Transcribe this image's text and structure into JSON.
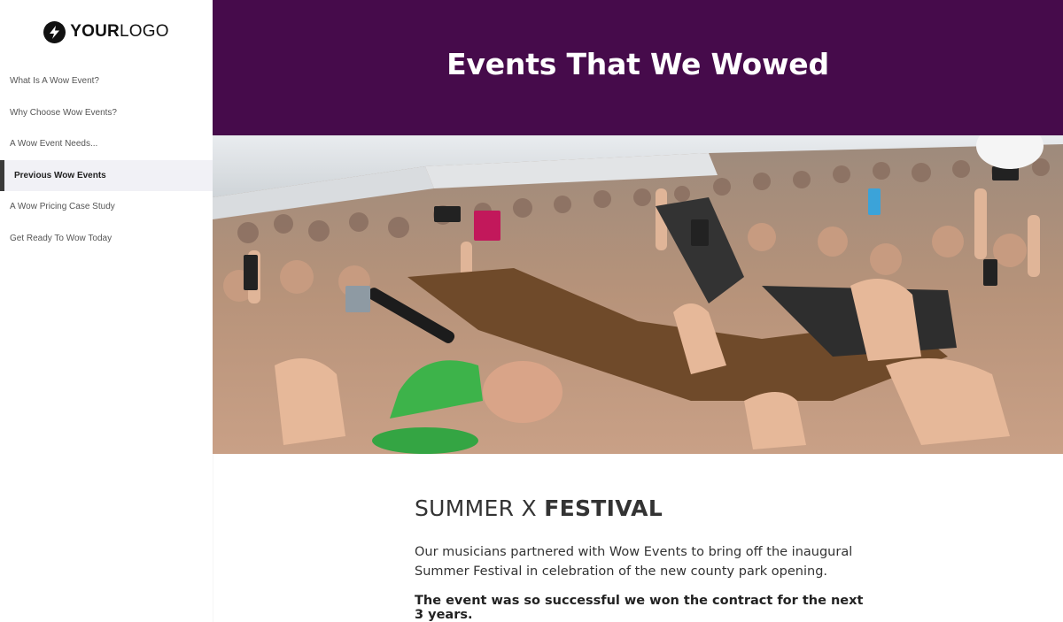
{
  "logo": {
    "bold": "YOUR",
    "light": "LOGO",
    "icon": "lightning-bolt-icon"
  },
  "sidebar": {
    "items": [
      {
        "label": "What Is A Wow Event?"
      },
      {
        "label": "Why Choose Wow Events?"
      },
      {
        "label": "A Wow Event Needs..."
      },
      {
        "label": "Previous Wow Events",
        "active": true
      },
      {
        "label": "A Wow Pricing Case Study"
      },
      {
        "label": "Get Ready To Wow Today"
      }
    ]
  },
  "header": {
    "title": "Events That We Wowed",
    "background": "#460b4b"
  },
  "hero": {
    "description_icon": "festival-crowd-photo"
  },
  "section": {
    "title_light": "SUMMER X ",
    "title_bold": "FESTIVAL",
    "description": "Our musicians partnered with Wow Events to bring off the inaugural Summer Festival in celebration of the new county park opening.",
    "highlight": "The event was so successful we won the contract for the next 3 years."
  },
  "colors": {
    "accent": "#460b4b",
    "active_nav_bg": "#f1f1f6",
    "active_nav_bar": "#3a3a3a"
  }
}
